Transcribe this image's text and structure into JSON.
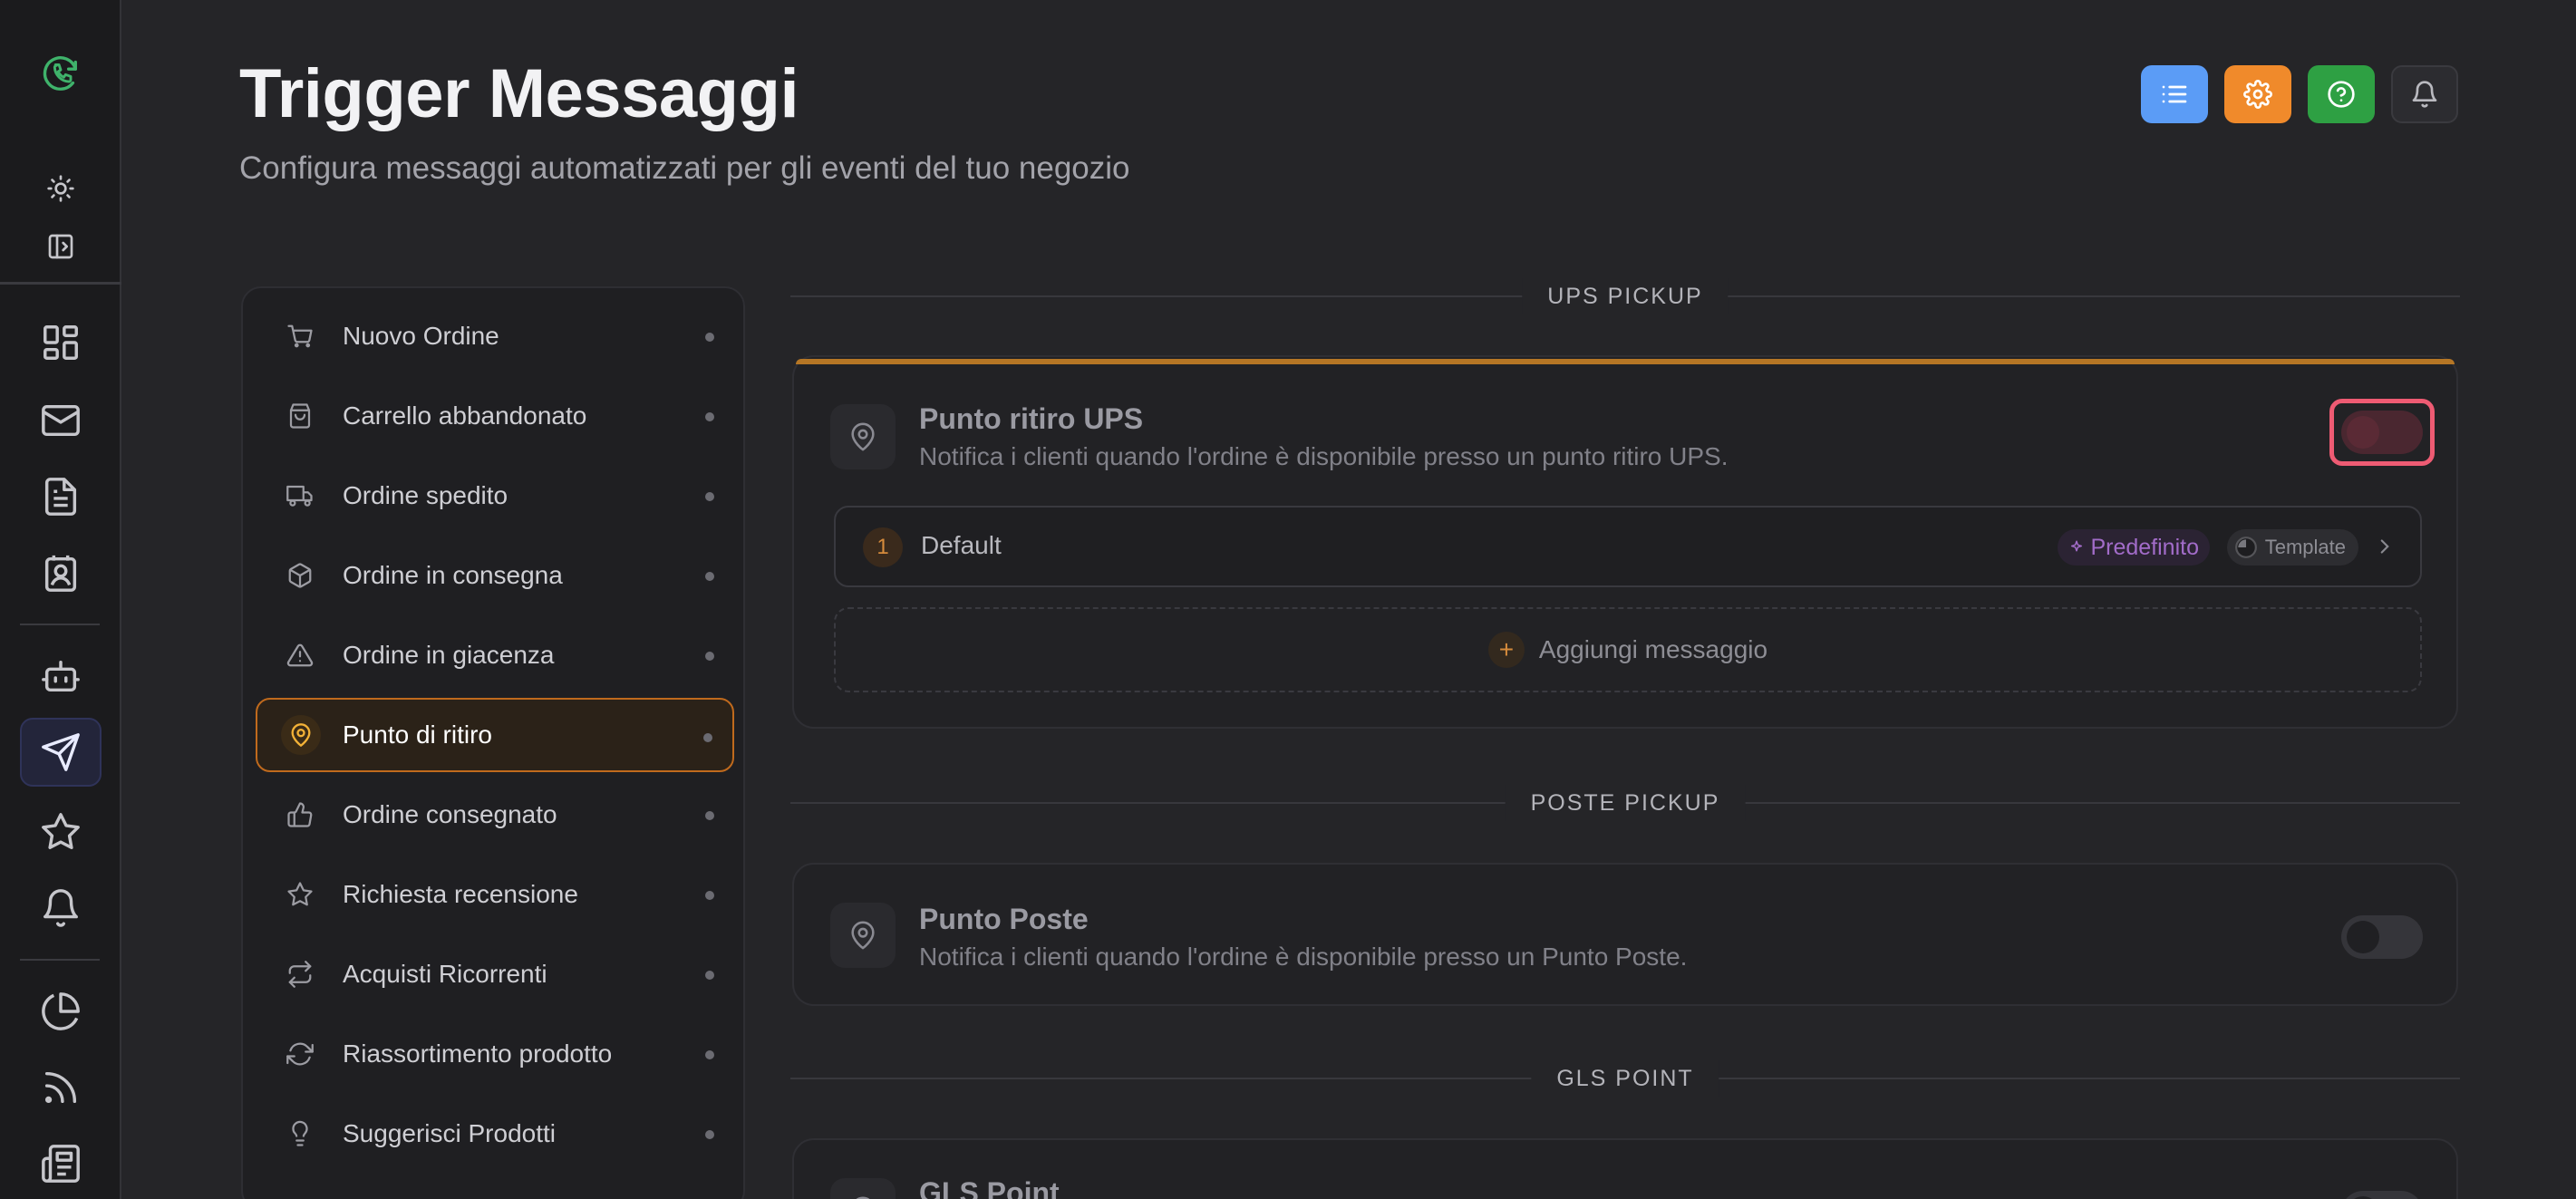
{
  "header": {
    "title": "Trigger Messaggi",
    "subtitle": "Configura messaggi automatizzati per gli eventi del tuo negozio"
  },
  "header_buttons": [
    {
      "icon": "list-icon",
      "color": "#5b9cf6"
    },
    {
      "icon": "gear-icon",
      "color": "#f08a2b"
    },
    {
      "icon": "help-icon",
      "color": "#2ea043"
    },
    {
      "icon": "bell-icon",
      "color": "#2c2c30"
    }
  ],
  "sidebar_rail": {
    "logo": "phone-refresh-logo",
    "accent": "#3fb36b",
    "active_item": "send-icon",
    "items": [
      "sun-icon",
      "panel-toggle-icon",
      "dashboard-icon",
      "mail-icon",
      "document-icon",
      "contact-icon",
      "bot-icon",
      "send-icon",
      "star-icon",
      "bell-icon",
      "pie-chart-icon",
      "rss-icon",
      "newspaper-icon"
    ]
  },
  "nav": {
    "items": [
      {
        "label": "Nuovo Ordine",
        "icon": "cart-icon"
      },
      {
        "label": "Carrello abbandonato",
        "icon": "bag-icon"
      },
      {
        "label": "Ordine spedito",
        "icon": "truck-icon"
      },
      {
        "label": "Ordine in consegna",
        "icon": "package-icon"
      },
      {
        "label": "Ordine in giacenza",
        "icon": "warning-icon"
      },
      {
        "label": "Punto di ritiro",
        "icon": "map-pin-icon",
        "selected": true
      },
      {
        "label": "Ordine consegnato",
        "icon": "thumbs-up-icon"
      },
      {
        "label": "Richiesta recensione",
        "icon": "star-icon"
      },
      {
        "label": "Acquisti Ricorrenti",
        "icon": "repeat-icon"
      },
      {
        "label": "Riassortimento prodotto",
        "icon": "refresh-icon"
      },
      {
        "label": "Suggerisci Prodotti",
        "icon": "lightbulb-icon"
      }
    ]
  },
  "sections": [
    {
      "heading": "UPS PICKUP",
      "card": {
        "title": "Punto ritiro UPS",
        "description": "Notifica i clienti quando l'ordine è disponibile presso un punto ritiro UPS.",
        "enabled": false,
        "messages": [
          {
            "number": "1",
            "name": "Default",
            "badge": "Predefinito",
            "type": "Template"
          }
        ],
        "add_label": "Aggiungi messaggio"
      }
    },
    {
      "heading": "POSTE PICKUP",
      "card": {
        "title": "Punto Poste",
        "description": "Notifica i clienti quando l'ordine è disponibile presso un Punto Poste.",
        "enabled": false
      }
    },
    {
      "heading": "GLS POINT",
      "card": {
        "title": "GLS Point"
      }
    }
  ]
}
